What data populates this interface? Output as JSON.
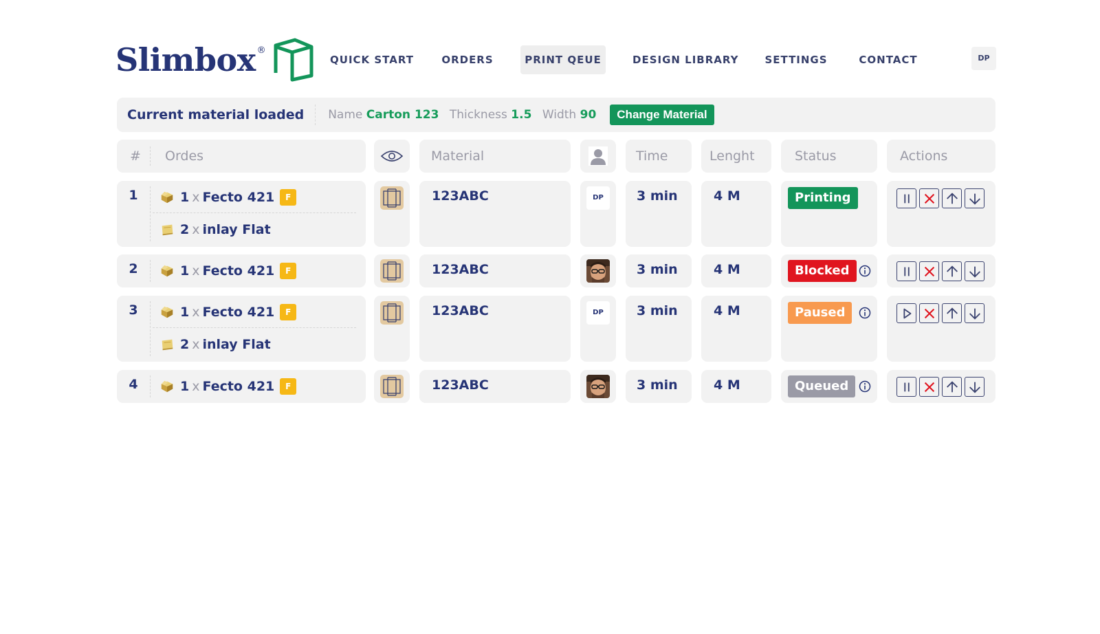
{
  "brand": {
    "name": "Slimbox",
    "reg": "®"
  },
  "nav": [
    {
      "label": "QUICK START",
      "active": false
    },
    {
      "label": "ORDERS",
      "active": false
    },
    {
      "label": "PRINT QEUE",
      "active": true
    },
    {
      "label": "DESIGN LIBRARY",
      "active": false
    },
    {
      "label": "SETTINGS",
      "active": false
    },
    {
      "label": "CONTACT",
      "active": false
    }
  ],
  "user_initials": "DP",
  "material": {
    "title": "Current material loaded",
    "name_label": "Name",
    "name_value": "Carton 123",
    "thickness_label": "Thickness",
    "thickness_value": "1.5",
    "width_label": "Width",
    "width_value": "90",
    "change_label": "Change Material"
  },
  "table": {
    "headers": {
      "index": "#",
      "orders": "Ordes",
      "preview_icon": "eye-icon",
      "material": "Material",
      "user_icon": "user-icon",
      "time": "Time",
      "length": "Lenght",
      "status": "Status",
      "actions": "Actions"
    },
    "rows": [
      {
        "index": "1",
        "orders": [
          {
            "qty": "1",
            "x": "x",
            "name": "Fecto 421",
            "badge": "F"
          },
          {
            "qty": "2",
            "x": "x",
            "name": "inlay Flat",
            "badge": ""
          }
        ],
        "material": "123ABC",
        "user": "DP",
        "time": "3 min",
        "length": "4 M",
        "status": "Printing",
        "status_color": "#13955a",
        "primary_action": "pause-icon"
      },
      {
        "index": "2",
        "orders": [
          {
            "qty": "1",
            "x": "x",
            "name": "Fecto 421",
            "badge": "F"
          }
        ],
        "material": "123ABC",
        "user": "photo",
        "time": "3 min",
        "length": "4 M",
        "status": "Blocked",
        "status_color": "#e0151f",
        "primary_action": "pause-icon"
      },
      {
        "index": "3",
        "orders": [
          {
            "qty": "1",
            "x": "x",
            "name": "Fecto 421",
            "badge": "F"
          },
          {
            "qty": "2",
            "x": "x",
            "name": "inlay Flat",
            "badge": ""
          }
        ],
        "material": "123ABC",
        "user": "DP",
        "time": "3 min",
        "length": "4 M",
        "status": "Paused",
        "status_color": "#f89a4f",
        "primary_action": "play-icon"
      },
      {
        "index": "4",
        "orders": [
          {
            "qty": "1",
            "x": "x",
            "name": "Fecto 421",
            "badge": "F"
          }
        ],
        "material": "123ABC",
        "user": "photo",
        "time": "3 min",
        "length": "4 M",
        "status": "Queued",
        "status_color": "#9a9aa6",
        "primary_action": "pause-icon"
      }
    ]
  },
  "colors": {
    "brand_navy": "#263476",
    "logo_green": "#13955a",
    "badge_yellow": "#f6b816",
    "cell_bg": "#f2f2f2",
    "cancel_red": "#e0151f"
  }
}
